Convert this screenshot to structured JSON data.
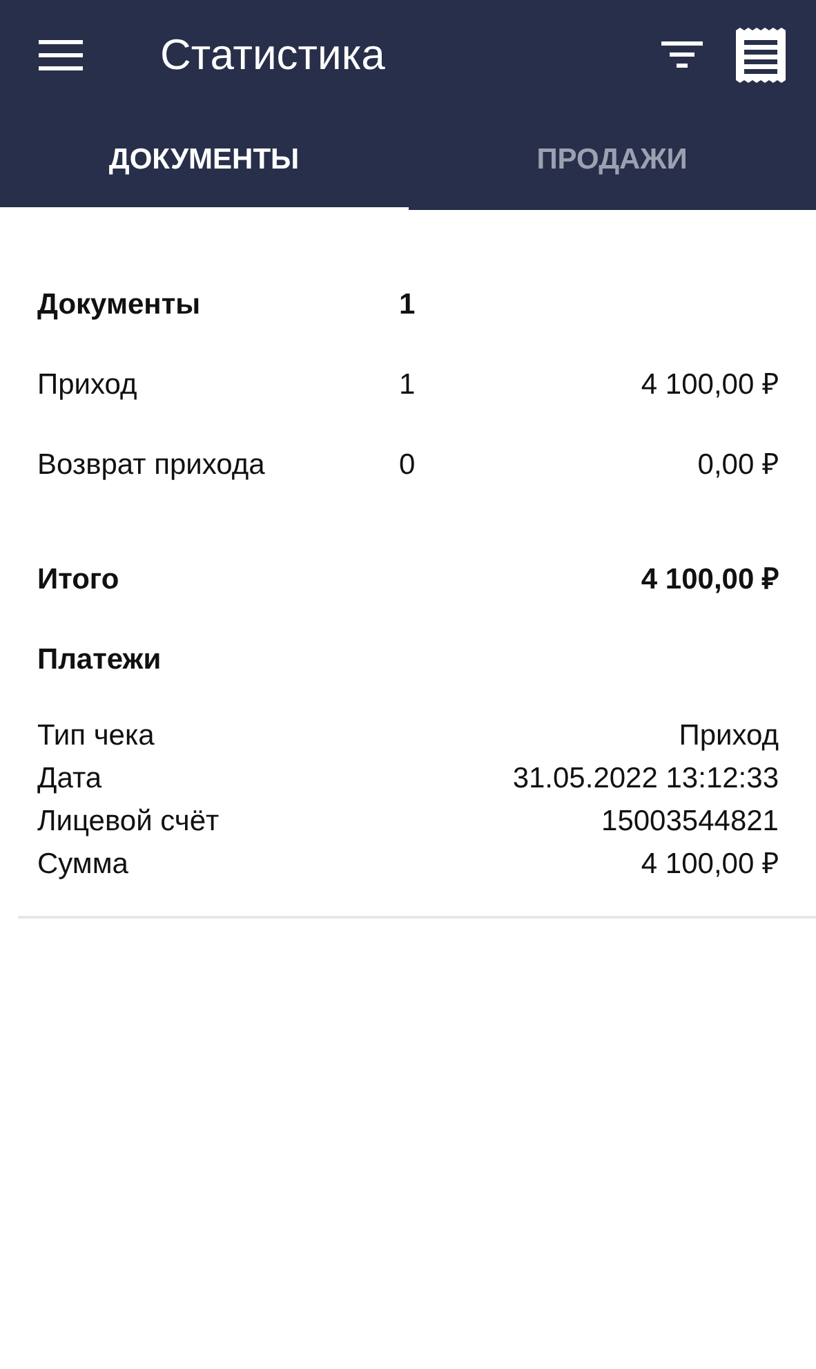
{
  "app_bar": {
    "title": "Статистика"
  },
  "tabs": [
    {
      "label": "ДОКУМЕНТЫ",
      "selected": true
    },
    {
      "label": "ПРОДАЖИ",
      "selected": false
    }
  ],
  "summary": [
    {
      "kind": "header",
      "label": "Документы",
      "count": "1"
    },
    {
      "kind": "row",
      "label": "Приход",
      "count": "1",
      "amount": "4 100,00 ₽"
    },
    {
      "kind": "row",
      "label": "Возврат прихода",
      "count": "0",
      "amount": "0,00 ₽"
    },
    {
      "kind": "total",
      "label": "Итого",
      "amount": "4 100,00 ₽"
    }
  ],
  "payments": {
    "title": "Платежи",
    "fields": [
      {
        "label": "Тип чека",
        "value": "Приход"
      },
      {
        "label": "Дата",
        "value": "31.05.2022 13:12:33"
      },
      {
        "label": "Лицевой счёт",
        "value": "15003544821"
      },
      {
        "label": "Сумма",
        "value": "4 100,00 ₽"
      }
    ]
  }
}
